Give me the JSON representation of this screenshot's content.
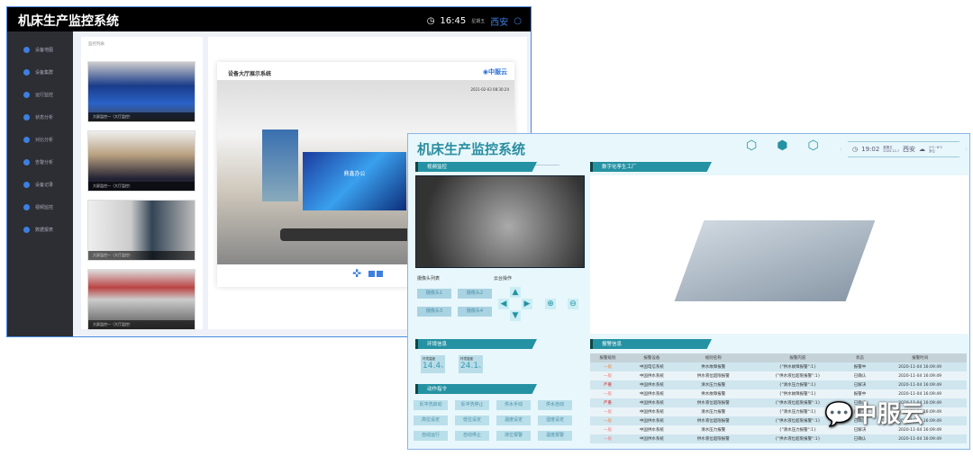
{
  "win1": {
    "title": "机床生产监控系统",
    "time": "16:45",
    "weekday": "星期五",
    "city": "西安",
    "sidebar": [
      "设备地图",
      "设备集群",
      "运行监控",
      "状态分析",
      "对比分析",
      "告警分析",
      "设备记录",
      "视频监控",
      "数据报表"
    ],
    "list_title": "监控列表",
    "thumb_caption": "大屏监控一（大厅监控）",
    "card_title": "设备大厅展示系统",
    "brand": "中服云",
    "timestamp": "2021-02-03 08:30:24",
    "screen_text": "鼎鑫办公"
  },
  "win2": {
    "title": "机床生产监控系统",
    "time": "19:02",
    "weekday": "星期五",
    "date": "2020-11-?",
    "city": "西安",
    "temp": "2℃~8℃",
    "weather": "多云",
    "sections": {
      "video": "视频监控",
      "twin": "数字化孪生工厂",
      "env": "环境信息",
      "cmd": "动作指令",
      "alarm": "报警信息"
    },
    "camera_list": "摄像头列表",
    "ptz": "云台操作",
    "cameras": [
      "摄像头1",
      "摄像头2",
      "摄像头3",
      "摄像头4"
    ],
    "env": [
      {
        "label": "环境温度",
        "value": "14.4",
        "unit": "℃"
      },
      {
        "label": "环境湿度",
        "value": "24.1",
        "unit": "%"
      }
    ],
    "commands": [
      "反冲洗启动",
      "反冲洗停止",
      "供水手动",
      "供水自动",
      "高位设定",
      "低位设定",
      "温度设定",
      "湿度设定",
      "自动运行",
      "自动停止",
      "液位报警",
      "温度报警"
    ],
    "alarm_headers": [
      "报警级别",
      "报警设备",
      "规则名称",
      "报警内容",
      "状态",
      "报警时间"
    ],
    "alarms": [
      [
        "一般",
        "中国电信系统",
        "供水故障报警",
        "{\"供水故障报警\":1}",
        "报警中",
        "2020-11-04 16:09:49"
      ],
      [
        "一般",
        "中国供水系统",
        "供水液位超限报警",
        "{\"供水液位超限报警\":1}",
        "已确认",
        "2020-11-04 16:09:49"
      ],
      [
        "严重",
        "中国供水系统",
        "清水压力报警",
        "{\"清水压力报警\":1}",
        "已解决",
        "2020-11-04 16:09:49"
      ],
      [
        "一般",
        "中国供水系统",
        "供水故障报警",
        "{\"供水故障报警\":1}",
        "报警中",
        "2020-11-04 16:09:49"
      ],
      [
        "严重",
        "中国供水系统",
        "供水液位超限报警",
        "{\"供水液位超限报警\":1}",
        "已确认",
        "2020-11-04 16:09:49"
      ],
      [
        "一般",
        "中国供水系统",
        "清水压力报警",
        "{\"清水压力报警\":1}",
        "已解决",
        "2020-11-04 16:09:49"
      ],
      [
        "一般",
        "中国供水系统",
        "供水液位超限报警",
        "{\"供水液位超限报警\":1}",
        "已确认",
        "2020-11-04 16:09:49"
      ],
      [
        "一般",
        "中国供水系统",
        "清水压力报警",
        "{\"清水压力报警\":1}",
        "已解决",
        "2020-11-04 16:09:49"
      ],
      [
        "一般",
        "中国供水系统",
        "供水液位超限报警",
        "{\"供水液位超限报警\":1}",
        "已确认",
        "2020-11-04 16:09:49"
      ]
    ],
    "level_colors": [
      "#f08a3c",
      "#f47a7a",
      "#e02020",
      "#f47a7a",
      "#e02020",
      "#f47a7a",
      "#f08a3c",
      "#f47a7a",
      "#f47a7a"
    ]
  },
  "watermark": "中服云"
}
